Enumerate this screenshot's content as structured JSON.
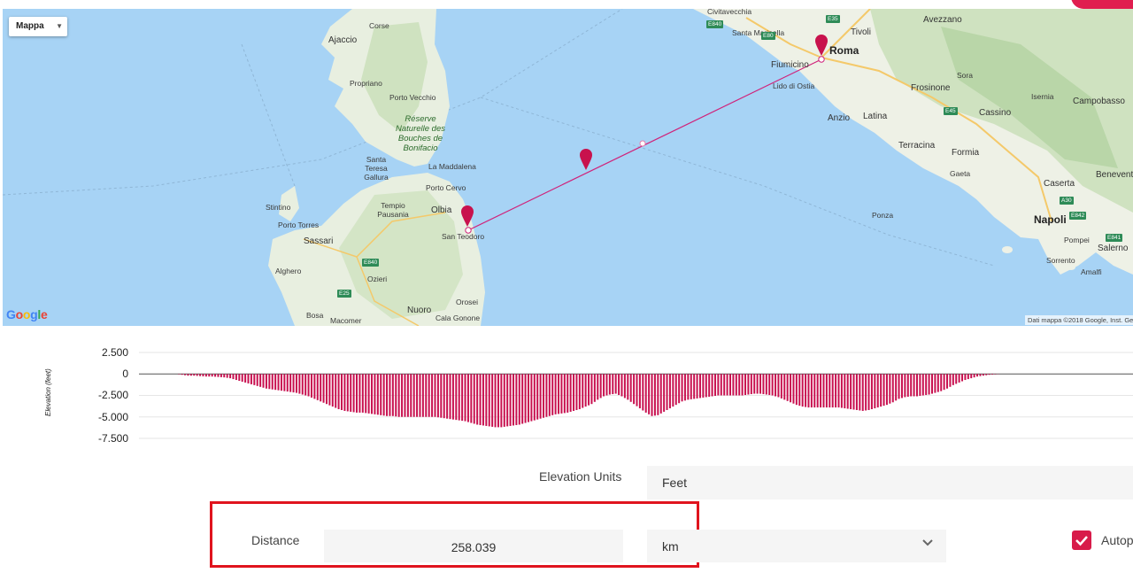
{
  "map": {
    "type_control": "Mappa",
    "cities": {
      "roma": "Roma",
      "napoli": "Napoli",
      "ajaccio": "Ajaccio",
      "sassari": "Sassari",
      "olbia": "Olbia",
      "nuoro": "Nuoro",
      "latina": "Latina",
      "avezzano": "Avezzano",
      "frosinone": "Frosinone",
      "cassino": "Cassino",
      "caserta": "Caserta",
      "salerno": "Salerno",
      "campobasso": "Campobasso",
      "benevento": "Benevento",
      "civitavecchia": "Civitavecchia",
      "fiumicino": "Fiumicino",
      "tivoli": "Tivoli",
      "anzio": "Anzio",
      "terracina": "Terracina",
      "formia": "Formia",
      "gaeta": "Gaeta",
      "ponza": "Ponza",
      "pompei": "Pompei",
      "sorrento": "Sorrento",
      "amalfi": "Amalfi",
      "isernia": "Isernia",
      "sora": "Sora",
      "corse": "Corse",
      "propriano": "Propriano",
      "porto_vecchio": "Porto Vecchio",
      "santa_teresa": "Santa Teresa Gallura",
      "la_maddalena": "La Maddalena",
      "porto_cervo": "Porto Cervo",
      "tempio": "Tempio Pausania",
      "san_teodoro": "San Teodoro",
      "stintino": "Stintino",
      "porto_torres": "Porto Torres",
      "alghero": "Alghero",
      "ozieri": "Ozieri",
      "orosei": "Orosei",
      "cala_gonone": "Cala Gonone",
      "bosa": "Bosa",
      "macomer": "Macomer",
      "santa_marinella": "Santa Marinella",
      "lido_ostia": "Lido di Ostia",
      "reserve": "Réserve Naturelle des Bouches de Bonifacio"
    },
    "roads": [
      "E35",
      "E840",
      "E80",
      "E45",
      "A30",
      "E842",
      "E841",
      "E840",
      "E25"
    ],
    "logo": "Google",
    "attribution": "Dati mappa ©2018 Google, Inst. Ge"
  },
  "chart_data": {
    "type": "bar",
    "title": "",
    "xlabel": "",
    "ylabel": "Elevation (feet)",
    "yticks": [
      "2.500",
      "0",
      "-2.500",
      "-5.000",
      "-7.500"
    ],
    "ylim": [
      -7500,
      2500
    ],
    "color": "#c8104f",
    "values": [
      0,
      0,
      0,
      0,
      0,
      0,
      0,
      -100,
      -200,
      -200,
      -250,
      -300,
      -300,
      -350,
      -400,
      -500,
      -700,
      -900,
      -1100,
      -1300,
      -1500,
      -1700,
      -1800,
      -1900,
      -2000,
      -2100,
      -2200,
      -2400,
      -2600,
      -2900,
      -3200,
      -3500,
      -3800,
      -4100,
      -4300,
      -4400,
      -4500,
      -4500,
      -4600,
      -4700,
      -4800,
      -4900,
      -4900,
      -5000,
      -5000,
      -5000,
      -5000,
      -5000,
      -5000,
      -5000,
      -5100,
      -5200,
      -5300,
      -5400,
      -5500,
      -5700,
      -5900,
      -6000,
      -6100,
      -6200,
      -6200,
      -6100,
      -6000,
      -5900,
      -5700,
      -5500,
      -5300,
      -5100,
      -4900,
      -4700,
      -4600,
      -4500,
      -4300,
      -4100,
      -3800,
      -3500,
      -3000,
      -2600,
      -2400,
      -2300,
      -2600,
      -3000,
      -3500,
      -4000,
      -4500,
      -4900,
      -4800,
      -4400,
      -4000,
      -3600,
      -3200,
      -3000,
      -2900,
      -2800,
      -2700,
      -2600,
      -2500,
      -2500,
      -2500,
      -2500,
      -2500,
      -2400,
      -2300,
      -2300,
      -2400,
      -2500,
      -2700,
      -3000,
      -3300,
      -3600,
      -3800,
      -3900,
      -3900,
      -3900,
      -3900,
      -3900,
      -3900,
      -4000,
      -4100,
      -4200,
      -4300,
      -4200,
      -4000,
      -3800,
      -3600,
      -3300,
      -2900,
      -2700,
      -2600,
      -2600,
      -2500,
      -2400,
      -2200,
      -2000,
      -1700,
      -1300,
      -1000,
      -700,
      -500,
      -300,
      -200,
      -100,
      -50,
      0,
      0,
      0,
      0,
      0,
      0,
      0,
      0,
      0,
      0,
      0,
      0,
      0,
      0,
      0,
      0,
      0,
      0,
      0,
      0,
      0,
      0
    ]
  },
  "settings": {
    "elevation_units_label": "Elevation Units",
    "elevation_units_value": "Feet",
    "distance_label": "Distance",
    "distance_value": "258.039",
    "distance_unit": "km",
    "autoplot_label": "Autop"
  }
}
